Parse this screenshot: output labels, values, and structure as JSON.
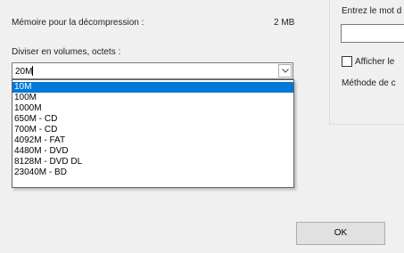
{
  "left_section": {
    "memory_label": "Mémoire pour la décompression :",
    "memory_value": "2 MB",
    "split_label": "Diviser en volumes, octets :",
    "split_combo_value": "20M"
  },
  "split_dropdown": {
    "selected_index": 0,
    "items": [
      "10M",
      "100M",
      "1000M",
      "650M - CD",
      "700M - CD",
      "4092M - FAT",
      "4480M - DVD",
      "8128M - DVD DL",
      "23040M - BD"
    ]
  },
  "right_section": {
    "password_label": "Entrez le mot d",
    "show_password_label": "Afficher le",
    "method_label": "Méthode de c"
  },
  "buttons": {
    "ok_label": "OK"
  },
  "icons": {
    "combo_arrow": "chevron-down-icon"
  }
}
